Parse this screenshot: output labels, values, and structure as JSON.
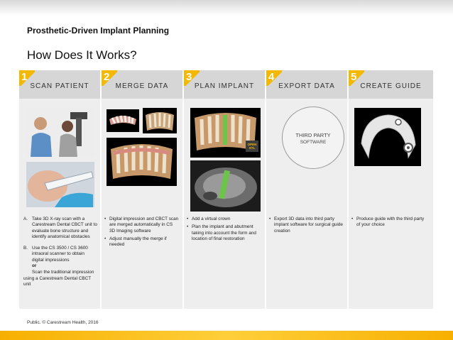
{
  "header": {
    "subtitle": "Prosthetic-Driven Implant Planning",
    "title": "How Does It Works?"
  },
  "steps": [
    {
      "number": "1",
      "label": "SCAN  PATIENT"
    },
    {
      "number": "2",
      "label": "MERGE  DATA"
    },
    {
      "number": "3",
      "label": "PLAN  IMPLANT"
    },
    {
      "number": "4",
      "label": "EXPORT  DATA"
    },
    {
      "number": "5",
      "label": "CREATE  GUIDE"
    }
  ],
  "third_party": {
    "line1": "THIRD PARTY",
    "line2": "SOFTWARE"
  },
  "badge": {
    "text": "OPEN STL"
  },
  "descriptions": {
    "scan": {
      "a_letter": "A.",
      "a_text": "Take 3D X-ray scan with a Carestream Dental CBCT unit to evaluate bone structure and identify anatomical obstacles",
      "b_letter": "B.",
      "b_text": "Use the CS 3500 / CS 3600 intraoral scanner to obtain digital impressions",
      "or_text": "or",
      "alt_text": "Scan the traditional impression using a Carestream Dental CBCT unit"
    },
    "merge": [
      "Digital impression and CBCT scan are merged automatically in CS 3D Imaging software",
      "Adjust manually the merge if needed"
    ],
    "plan": [
      "Add a virtual crown",
      "Plan the implant and abutment taking into account the form and location of final restoration"
    ],
    "export": [
      "Export 3D data into third party implant software for surgical guide creation"
    ],
    "guide": [
      "Produce guide with the third party of your choice"
    ]
  },
  "footer": {
    "text": "Public. © Carestream Health, 2016"
  },
  "colors": {
    "accent": "#f5b800",
    "header_row": "#d6d6d6",
    "panel": "#eeeeee"
  },
  "icons": [
    "patient-scan-photo",
    "intraoral-scanner-photo",
    "dental-model-3d",
    "cbct-slice",
    "surgical-guide-model"
  ]
}
